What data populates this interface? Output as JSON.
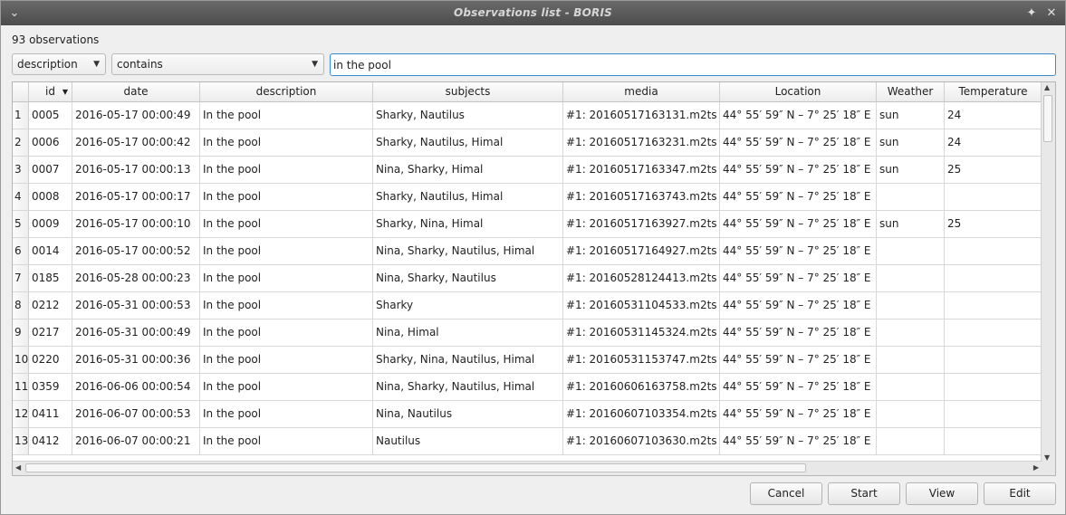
{
  "window": {
    "title": "Observations list - BORIS"
  },
  "observation_count": "93 observations",
  "filter": {
    "field": "description",
    "operator": "contains",
    "value": "in the pool"
  },
  "table": {
    "columns": [
      "id",
      "date",
      "description",
      "subjects",
      "media",
      "Location",
      "Weather",
      "Temperature"
    ],
    "rows": [
      {
        "n": "1",
        "id": "0005",
        "date": "2016-05-17 00:00:49",
        "description": "In the pool",
        "subjects": "Sharky, Nautilus",
        "media": "#1: 20160517163131.m2ts",
        "location": "44° 55′ 59″ N – 7° 25′ 18″ E",
        "weather": "sun",
        "temperature": "24"
      },
      {
        "n": "2",
        "id": "0006",
        "date": "2016-05-17 00:00:42",
        "description": "In the pool",
        "subjects": "Sharky, Nautilus, Himal",
        "media": "#1: 20160517163231.m2ts",
        "location": "44° 55′ 59″ N – 7° 25′ 18″ E",
        "weather": "sun",
        "temperature": "24"
      },
      {
        "n": "3",
        "id": "0007",
        "date": "2016-05-17 00:00:13",
        "description": "In the pool",
        "subjects": "Nina, Sharky, Himal",
        "media": "#1: 20160517163347.m2ts",
        "location": "44° 55′ 59″ N – 7° 25′ 18″ E",
        "weather": "sun",
        "temperature": "25"
      },
      {
        "n": "4",
        "id": "0008",
        "date": "2016-05-17 00:00:17",
        "description": "In the pool",
        "subjects": "Sharky, Nautilus, Himal",
        "media": "#1: 20160517163743.m2ts",
        "location": "44° 55′ 59″ N – 7° 25′ 18″ E",
        "weather": "",
        "temperature": ""
      },
      {
        "n": "5",
        "id": "0009",
        "date": "2016-05-17 00:00:10",
        "description": "In the pool",
        "subjects": "Sharky, Nina, Himal",
        "media": "#1: 20160517163927.m2ts",
        "location": "44° 55′ 59″ N – 7° 25′ 18″ E",
        "weather": "sun",
        "temperature": "25"
      },
      {
        "n": "6",
        "id": "0014",
        "date": "2016-05-17 00:00:52",
        "description": "In the pool",
        "subjects": "Nina, Sharky, Nautilus, Himal",
        "media": "#1: 20160517164927.m2ts",
        "location": "44° 55′ 59″ N – 7° 25′ 18″ E",
        "weather": "",
        "temperature": ""
      },
      {
        "n": "7",
        "id": "0185",
        "date": "2016-05-28 00:00:23",
        "description": "In the pool",
        "subjects": "Nina, Sharky, Nautilus",
        "media": "#1: 20160528124413.m2ts",
        "location": "44° 55′ 59″ N – 7° 25′ 18″ E",
        "weather": "",
        "temperature": ""
      },
      {
        "n": "8",
        "id": "0212",
        "date": "2016-05-31 00:00:53",
        "description": "In the pool",
        "subjects": "Sharky",
        "media": "#1: 20160531104533.m2ts",
        "location": "44° 55′ 59″ N – 7° 25′ 18″ E",
        "weather": "",
        "temperature": ""
      },
      {
        "n": "9",
        "id": "0217",
        "date": "2016-05-31 00:00:49",
        "description": "In the pool",
        "subjects": "Nina, Himal",
        "media": "#1: 20160531145324.m2ts",
        "location": "44° 55′ 59″ N – 7° 25′ 18″ E",
        "weather": "",
        "temperature": ""
      },
      {
        "n": "10",
        "id": "0220",
        "date": "2016-05-31 00:00:36",
        "description": "In the pool",
        "subjects": "Sharky, Nina, Nautilus, Himal",
        "media": "#1: 20160531153747.m2ts",
        "location": "44° 55′ 59″ N – 7° 25′ 18″ E",
        "weather": "",
        "temperature": ""
      },
      {
        "n": "11",
        "id": "0359",
        "date": "2016-06-06 00:00:54",
        "description": "In the pool",
        "subjects": "Nina, Sharky, Nautilus, Himal",
        "media": "#1: 20160606163758.m2ts",
        "location": "44° 55′ 59″ N – 7° 25′ 18″ E",
        "weather": "",
        "temperature": ""
      },
      {
        "n": "12",
        "id": "0411",
        "date": "2016-06-07 00:00:53",
        "description": "In the pool",
        "subjects": "Nina, Nautilus",
        "media": "#1: 20160607103354.m2ts",
        "location": "44° 55′ 59″ N – 7° 25′ 18″ E",
        "weather": "",
        "temperature": ""
      },
      {
        "n": "13",
        "id": "0412",
        "date": "2016-06-07 00:00:21",
        "description": "In the pool",
        "subjects": "Nautilus",
        "media": "#1: 20160607103630.m2ts",
        "location": "44° 55′ 59″ N – 7° 25′ 18″ E",
        "weather": "",
        "temperature": ""
      }
    ]
  },
  "buttons": {
    "cancel": "Cancel",
    "start": "Start",
    "view": "View",
    "edit": "Edit"
  }
}
